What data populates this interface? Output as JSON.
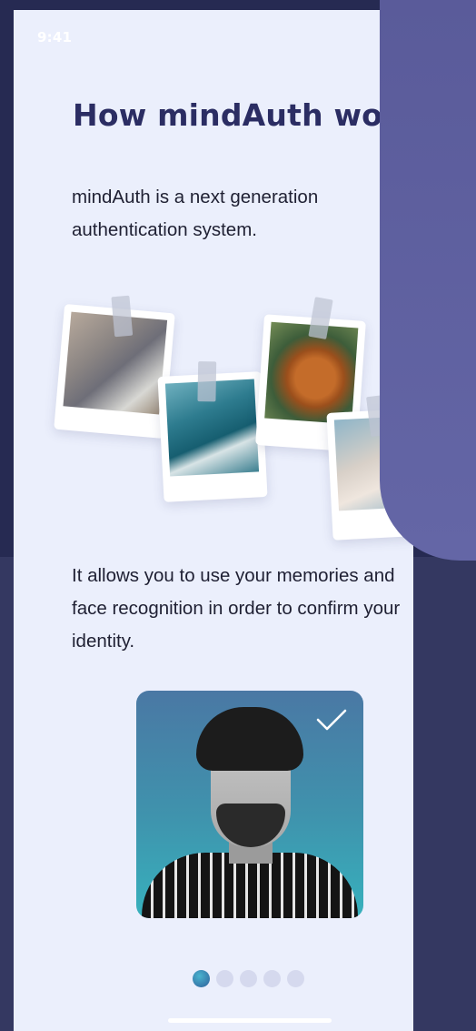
{
  "status_bar": {
    "time": "9:41"
  },
  "onboarding": {
    "title": "How mindAuth wo",
    "intro_text": "mindAuth is a next generation authentication system.",
    "memories_text": "It allows you to use your memories and face recognition in order to confirm your identity.",
    "photos": [
      {
        "name": "couple-photo"
      },
      {
        "name": "airplane-wing-photo"
      },
      {
        "name": "dog-photo"
      },
      {
        "name": "hand-photo"
      }
    ],
    "face_check": {
      "icon": "checkmark-icon"
    },
    "pagination": {
      "total": 5,
      "active_index": 0
    }
  },
  "colors": {
    "screen_background": "#ebeffc",
    "title": "#2b2d63",
    "overlay_panel": "#5f60a0",
    "dot_inactive": "#d5d9ee",
    "dot_active": "#3a86b4"
  }
}
